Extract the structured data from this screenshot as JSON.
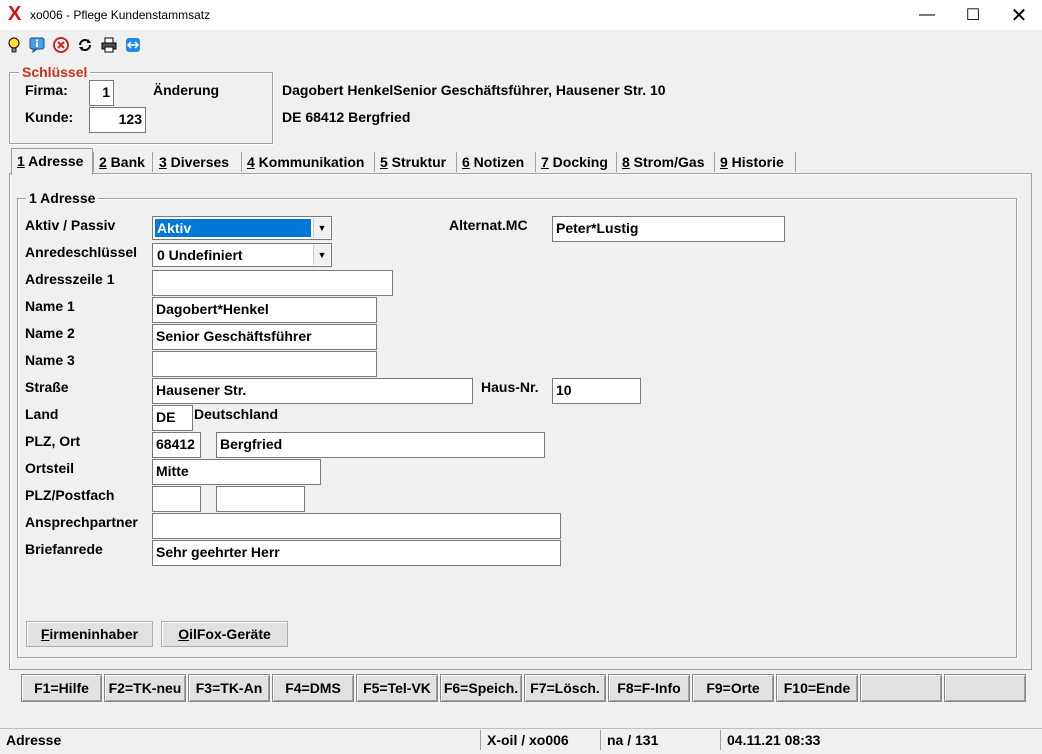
{
  "window": {
    "title": "xo006 - Pflege Kundenstammsatz",
    "app_glyph": "X"
  },
  "toolbar": {
    "icons": [
      "lightbulb-icon",
      "info-icon",
      "cancel-icon",
      "refresh-icon",
      "print-icon",
      "remote-icon"
    ]
  },
  "key": {
    "group_label": "Schlüssel",
    "firma_label": "Firma:",
    "firma_value": "1",
    "kunde_label": "Kunde:",
    "kunde_value": "123",
    "mode": "Änderung"
  },
  "header": {
    "line1": "Dagobert HenkelSenior Geschäftsführer, Hausener Str. 10",
    "line2": "DE 68412 Bergfried"
  },
  "tabs": [
    {
      "key": "1",
      "label": " Adresse"
    },
    {
      "key": "2",
      "label": " Bank"
    },
    {
      "key": "3",
      "label": " Diverses"
    },
    {
      "key": "4",
      "label": " Kommunikation"
    },
    {
      "key": "5",
      "label": " Struktur"
    },
    {
      "key": "6",
      "label": " Notizen"
    },
    {
      "key": "7",
      "label": " Docking"
    },
    {
      "key": "8",
      "label": " Strom/Gas"
    },
    {
      "key": "9",
      "label": " Historie"
    }
  ],
  "address": {
    "group_label": "1 Adresse",
    "aktiv_label": "Aktiv / Passiv",
    "aktiv_value": "Aktiv",
    "anrede_label": "Anredeschlüssel",
    "anrede_value": "0 Undefiniert",
    "adresszeile_label": "Adresszeile 1",
    "adresszeile_value": "",
    "name1_label": "Name 1",
    "name1_value": "Dagobert*Henkel",
    "name2_label": "Name 2",
    "name2_value": "Senior Geschäftsführer",
    "name3_label": "Name 3",
    "name3_value": "",
    "strasse_label": "Straße",
    "strasse_value": "Hausener Str.",
    "hausnr_label": "Haus-Nr.",
    "hausnr_value": "10",
    "land_label": "Land",
    "land_value": "DE",
    "land_name": "Deutschland",
    "plz_ort_label": "PLZ, Ort",
    "plz_value": "68412",
    "ort_value": "Bergfried",
    "ortsteil_label": "Ortsteil",
    "ortsteil_value": "Mitte",
    "postfach_label": "PLZ/Postfach",
    "postfach_plz": "",
    "postfach_value": "",
    "ansprech_label": "Ansprechpartner",
    "ansprech_value": "",
    "briefanrede_label": "Briefanrede",
    "briefanrede_value": "Sehr geehrter Herr",
    "altmc_label": "Alternat.MC",
    "altmc_value": "Peter*Lustig"
  },
  "buttons": {
    "firmeninhaber_u": "F",
    "firmeninhaber_rest": "irmeninhaber",
    "oilfox_u": "O",
    "oilfox_rest": "ilFox-Geräte"
  },
  "fkeys": [
    "F1=Hilfe",
    "F2=TK-neu",
    "F3=TK-An",
    "F4=DMS",
    "F5=Tel-VK",
    "F6=Speich.",
    "F7=Lösch.",
    "F8=F-Info",
    "F9=Orte",
    "F10=Ende",
    "",
    ""
  ],
  "status": {
    "section": "Adresse",
    "program": "X-oil / xo006",
    "record": "na / 131",
    "datetime": "04.11.21 08:33"
  },
  "colors": {
    "accent": "#0078d7",
    "group_title": "#c8321e",
    "app_icon": "#e01010"
  }
}
